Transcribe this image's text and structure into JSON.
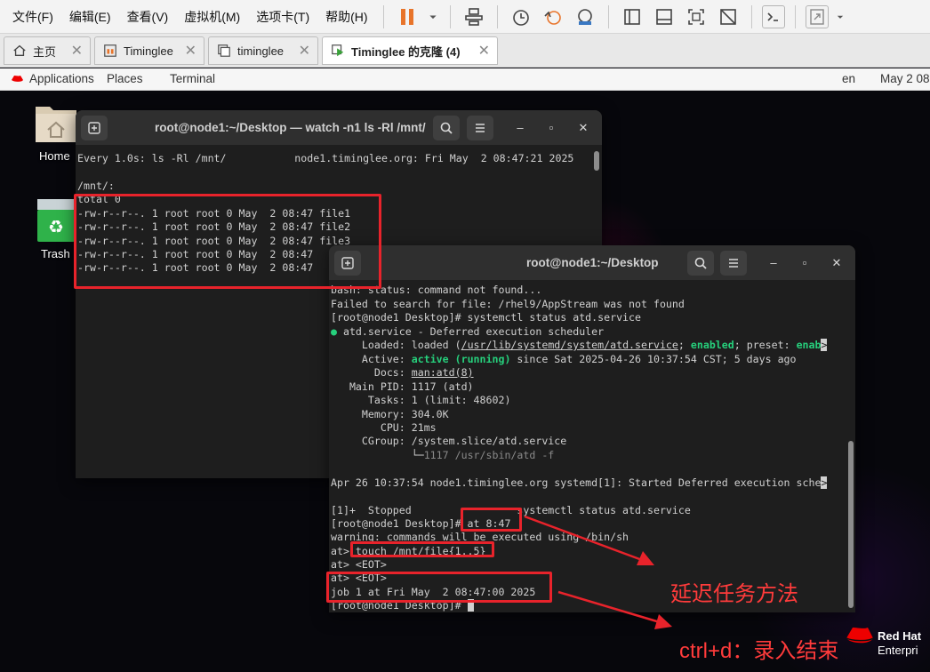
{
  "menubar": {
    "items": [
      "文件(F)",
      "编辑(E)",
      "查看(V)",
      "虚拟机(M)",
      "选项卡(T)",
      "帮助(H)"
    ],
    "toolbar_icons": [
      "pause-icon",
      "dropdown-arrow-icon",
      "send-ctrl-alt-del-icon",
      "snapshot-icon",
      "revert-snapshot-icon",
      "snapshot-manager-icon",
      "normal-view-icon",
      "no-tabs-view-icon",
      "fit-guest-icon",
      "unity-icon",
      "console-view-icon",
      "stretch-view-icon",
      "dropdown-arrow-icon"
    ]
  },
  "tabs": [
    {
      "label": "主页",
      "icon": "home-icon"
    },
    {
      "label": "Timinglee",
      "icon": "vm-icon"
    },
    {
      "label": "timinglee",
      "icon": "vm-icon"
    },
    {
      "label": "Timinglee 的克隆 (4)",
      "icon": "vm-running-icon",
      "active": true
    }
  ],
  "gnome": {
    "applications": "Applications",
    "places": "Places",
    "terminal": "Terminal",
    "lang": "en",
    "clock": "May 2 08"
  },
  "desktop": {
    "home_label": "Home",
    "trash_label": "Trash"
  },
  "term1": {
    "title": "root@node1:~/Desktop — watch -n1 ls -Rl /mnt/",
    "lines": [
      "Every 1.0s: ls -Rl /mnt/           node1.timinglee.org: Fri May  2 08:47:21 2025",
      "",
      "/mnt/:",
      "total 0",
      "-rw-r--r--. 1 root root 0 May  2 08:47 file1",
      "-rw-r--r--. 1 root root 0 May  2 08:47 file2",
      "-rw-r--r--. 1 root root 0 May  2 08:47 file3",
      "-rw-r--r--. 1 root root 0 May  2 08:47 ",
      "-rw-r--r--. 1 root root 0 May  2 08:47 "
    ]
  },
  "term2": {
    "title": "root@node1:~/Desktop",
    "lines": {
      "l0": "bash: status: command not found...",
      "l1": "Failed to search for file: /rhel9/AppStream was not found",
      "l2": "[root@node1 Desktop]# systemctl status atd.service",
      "l3_dot": "●",
      "l3": " atd.service - Deferred execution scheduler",
      "l4a": "     Loaded: loaded (",
      "l4b": "/usr/lib/systemd/system/atd.service",
      "l4c": "; ",
      "l4d": "enabled",
      "l4e": "; preset: ",
      "l4f": "enab",
      "l4g": ">",
      "l5a": "     Active: ",
      "l5b": "active (running)",
      "l5c": " since Sat 2025-04-26 10:37:54 CST; 5 days ago",
      "l6a": "       Docs: ",
      "l6b": "man:atd(8)",
      "l7": "   Main PID: 1117 (atd)",
      "l8": "      Tasks: 1 (limit: 48602)",
      "l9": "     Memory: 304.0K",
      "l10": "        CPU: 21ms",
      "l11": "     CGroup: /system.slice/atd.service",
      "l12a": "             └─",
      "l12b": "1117 /usr/sbin/atd -f",
      "l13": "",
      "l14a": "Apr 26 10:37:54 node1.timinglee.org systemd[1]: Started Deferred execution sche",
      "l14b": ">",
      "l15": "",
      "l16": "[1]+  Stopped                 systemctl status atd.service",
      "l17": "[root@node1 Desktop]# at 8:47",
      "l18": "warning: commands will be executed using /bin/sh",
      "l19": "at> touch /mnt/file{1..5}",
      "l20": "at> <EOT>",
      "l21": "at> <EOT>",
      "l22": "job 1 at Fri May  2 08:47:00 2025",
      "l23": "[root@node1 Desktop]# "
    }
  },
  "annotations": {
    "delay_method": "延迟任务方法",
    "ctrl_d": "ctrl+d：录入结束"
  },
  "brand": {
    "line1": "Red Hat",
    "line2": "Enterpri"
  },
  "colors": {
    "annotation_red": "#e8232b",
    "terminal_green": "#26d07c",
    "terminal_bg": "#1e1e1e"
  }
}
